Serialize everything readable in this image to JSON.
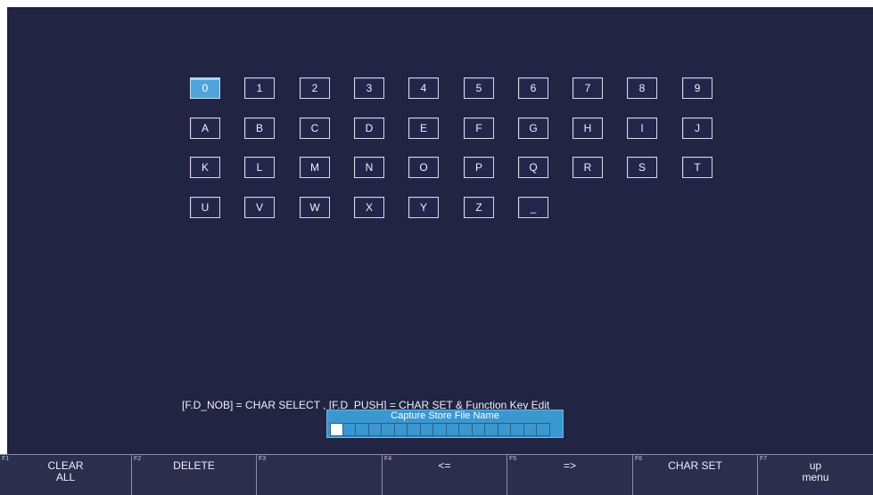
{
  "keyboard": {
    "rows": [
      [
        "0",
        "1",
        "2",
        "3",
        "4",
        "5",
        "6",
        "7",
        "8",
        "9"
      ],
      [
        "A",
        "B",
        "C",
        "D",
        "E",
        "F",
        "G",
        "H",
        "I",
        "J"
      ],
      [
        "K",
        "L",
        "M",
        "N",
        "O",
        "P",
        "Q",
        "R",
        "S",
        "T"
      ],
      [
        "U",
        "V",
        "W",
        "X",
        "Y",
        "Z",
        "_"
      ]
    ],
    "selected": "0"
  },
  "help_text": "[F.D_NOB] = CHAR SELECT , [F.D_PUSH] = CHAR SET & Function Key Edit",
  "dialog": {
    "title": "Capture Store File Name",
    "cell_count": 17,
    "cursor_index": 0
  },
  "function_keys": [
    {
      "num": "F1",
      "label": "CLEAR\nALL"
    },
    {
      "num": "F2",
      "label": "DELETE"
    },
    {
      "num": "F3",
      "label": ""
    },
    {
      "num": "F4",
      "label": "<="
    },
    {
      "num": "F5",
      "label": "=>"
    },
    {
      "num": "F6",
      "label": "CHAR SET"
    },
    {
      "num": "F7",
      "label": "up\nmenu"
    }
  ],
  "colors": {
    "background": "#212442",
    "selected_key": "#4fa4d9",
    "dialog": "#3b97cf",
    "function_bar": "#2b2e4c"
  }
}
